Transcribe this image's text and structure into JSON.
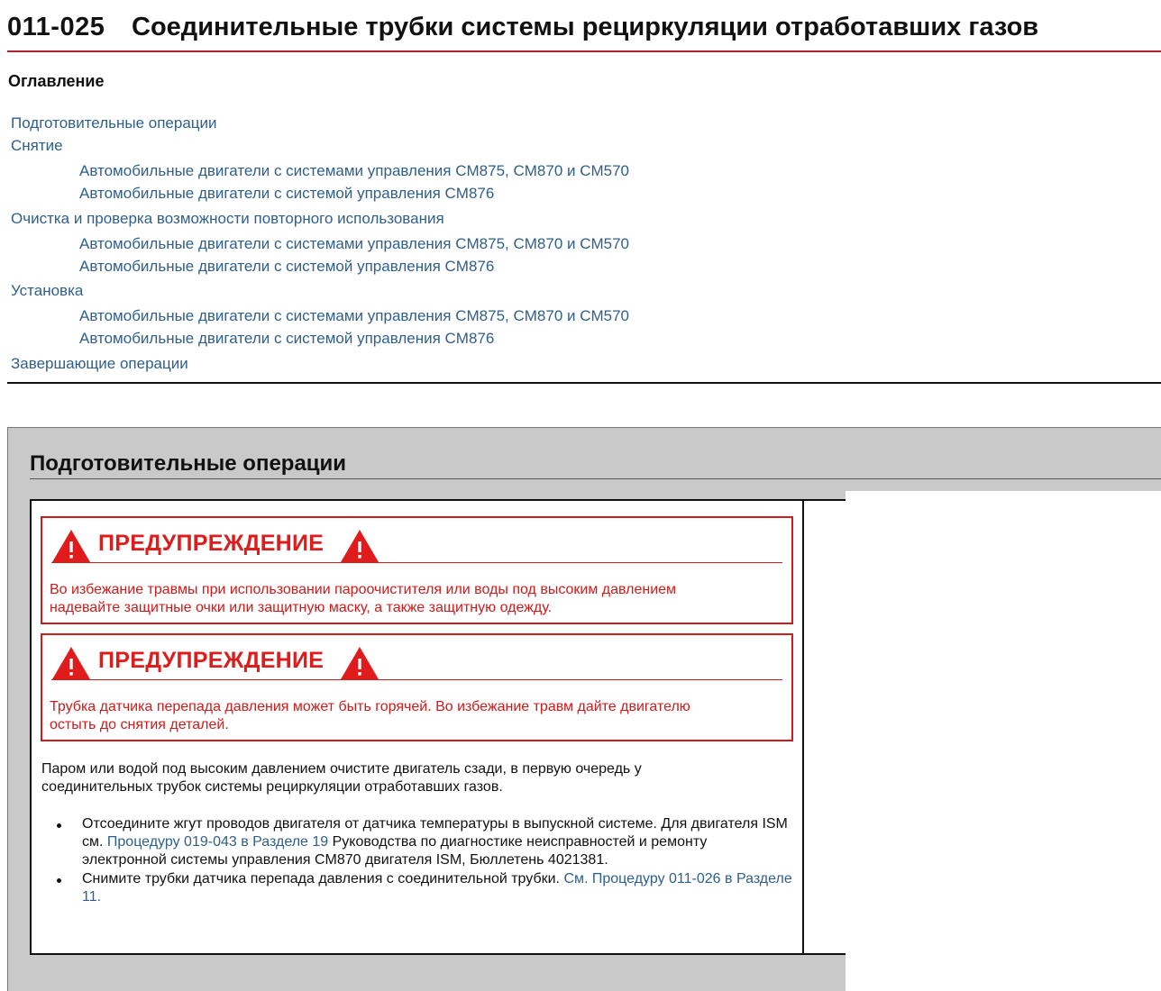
{
  "header": {
    "number": "011-025",
    "title": "Соединительные трубки системы рециркуляции отработавших газов"
  },
  "toc": {
    "heading": "Оглавление",
    "items": [
      {
        "label": "Подготовительные операции"
      },
      {
        "label": "Снятие"
      },
      {
        "label": "Автомобильные двигатели с системами управления CM875, CM870 и CM570"
      },
      {
        "label": "Автомобильные двигатели с системой управления CM876"
      },
      {
        "label": "Очистка и проверка возможности повторного использования"
      },
      {
        "label": "Автомобильные двигатели с системами управления CM875, CM870 и CM570"
      },
      {
        "label": "Автомобильные двигатели с системой управления CM876"
      },
      {
        "label": "Установка"
      },
      {
        "label": "Автомобильные двигатели с системами управления CM875, CM870 и CM570"
      },
      {
        "label": "Автомобильные двигатели с системой управления CM876"
      },
      {
        "label": "Завершающие операции"
      }
    ]
  },
  "section": {
    "title": "Подготовительные операции",
    "warnings": [
      {
        "title": "ПРЕДУПРЕЖДЕНИЕ",
        "text_line1": "Во избежание травмы при использовании пароочистителя или воды под высоким давлением",
        "text_line2": "надевайте защитные очки или защитную маску, а также защитную одежду."
      },
      {
        "title": "ПРЕДУПРЕЖДЕНИЕ",
        "text_line1": "Трубка датчика перепада давления может быть горячей. Во избежание травм дайте двигателю",
        "text_line2": "остыть до снятия деталей."
      }
    ],
    "paragraph_line1": "Паром или водой под высоким давлением очистите двигатель сзади, в первую очередь у",
    "paragraph_line2": "соединительных трубок системы рециркуляции отработавших газов.",
    "bullets": [
      {
        "text1": "Отсоедините жгут проводов двигателя от датчика температуры в выпускной системе. Для двигателя ISM см. ",
        "link": "Процедуру 019-043 в Разделе 19",
        "text2": " Руководства по диагностике неисправностей и ремонту электронной системы управления CM870 двигателя ISM, Бюллетень 4021381."
      },
      {
        "text1": "Снимите трубки датчика перепада давления с соединительной трубки. ",
        "link": "См. Процедуру 011-026 в Разделе 11.",
        "text2": ""
      }
    ]
  },
  "colors": {
    "accent_red": "#d11a1a",
    "link_blue": "#2f5f8a",
    "header_rule": "#b0202e",
    "panel_gray": "#c9c9c9"
  },
  "icons": [
    "warning-triangle-icon"
  ]
}
